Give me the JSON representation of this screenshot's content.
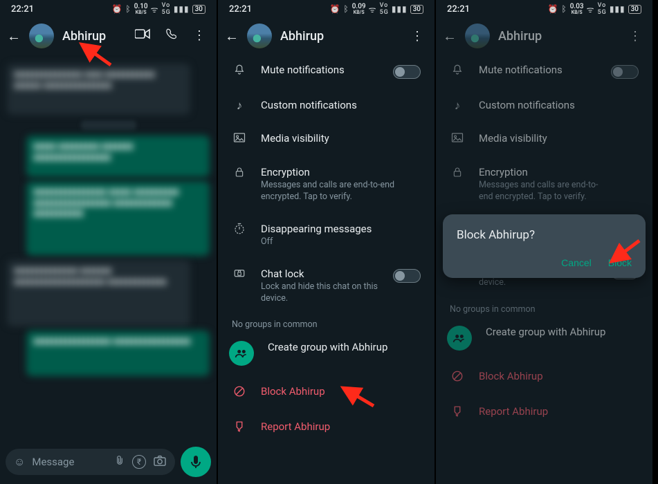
{
  "status": {
    "time": "22:21",
    "kbps1": "0.10",
    "kbps2": "0.09",
    "kbps3": "0.03",
    "kbps_unit": "KB/S",
    "battery": "30"
  },
  "contact": {
    "name": "Abhirup"
  },
  "chat": {
    "input_placeholder": "Message"
  },
  "settings": {
    "mute": {
      "title": "Mute notifications"
    },
    "custom": {
      "title": "Custom notifications"
    },
    "media": {
      "title": "Media visibility"
    },
    "encryption": {
      "title": "Encryption",
      "sub": "Messages and calls are end-to-end encrypted. Tap to verify."
    },
    "disappear": {
      "title": "Disappearing messages",
      "sub": "Off"
    },
    "chatlock": {
      "title": "Chat lock",
      "sub": "Lock and hide this chat on this device."
    },
    "groups_label": "No groups in common",
    "create_group": "Create group with Abhirup",
    "block": "Block Abhirup",
    "report": "Report Abhirup"
  },
  "dialog": {
    "title": "Block Abhirup?",
    "cancel": "Cancel",
    "confirm": "Block"
  }
}
